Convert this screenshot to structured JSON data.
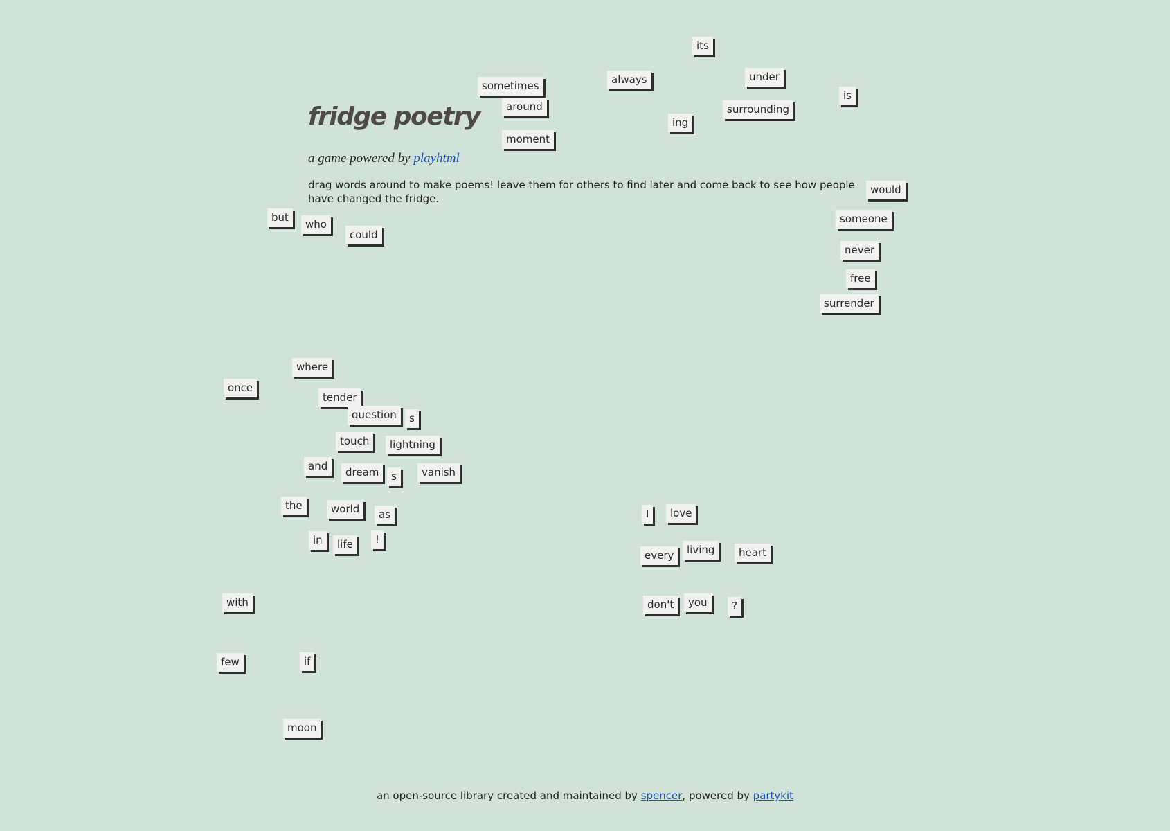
{
  "title": "fridge poetry",
  "subtitle": {
    "prefix": "a game powered by ",
    "link": "playhtml"
  },
  "intro": "drag words around to make poems! leave them for others to find later and come back to see how people have changed the fridge.",
  "footer": {
    "prefix": "an open-source library created and maintained by ",
    "author_link": "spencer",
    "middle": ", powered by ",
    "platform_link": "partykit"
  },
  "words": [
    "its",
    "always",
    "under",
    "sometimes",
    "around",
    "is",
    "ing",
    "surrounding",
    "moment",
    "would",
    "someone",
    "never",
    "free",
    "surrender",
    "but",
    "who",
    "could",
    "where",
    "once",
    "tender",
    "question",
    "s",
    "touch",
    "lightning",
    "and",
    "dream",
    "s",
    "vanish",
    "the",
    "world",
    "as",
    "in",
    "life",
    "!",
    "with",
    "few",
    "if",
    "moon",
    "I",
    "love",
    "every",
    "living",
    "heart",
    "don't",
    "you",
    "?"
  ]
}
